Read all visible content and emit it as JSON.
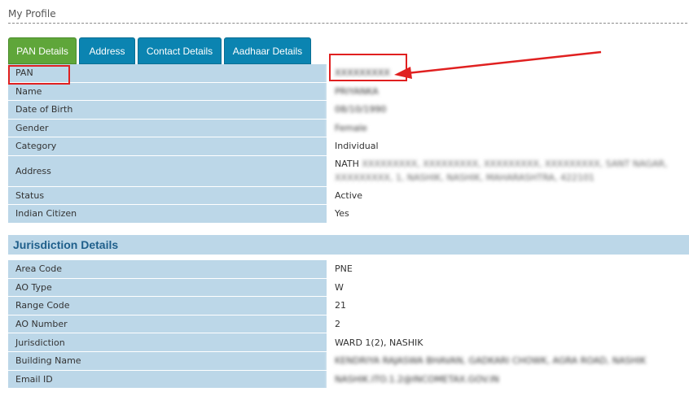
{
  "page": {
    "heading": "My Profile"
  },
  "tabs": [
    {
      "label": "PAN Details",
      "active": true
    },
    {
      "label": "Address",
      "active": false
    },
    {
      "label": "Contact Details",
      "active": false
    },
    {
      "label": "Aadhaar Details",
      "active": false
    }
  ],
  "pan_details": {
    "rows": [
      {
        "label": "PAN",
        "value": "XXXXXXXXX"
      },
      {
        "label": "Name",
        "value": "PRIYANKA"
      },
      {
        "label": "Date of Birth",
        "value": "08/10/1990"
      },
      {
        "label": "Gender",
        "value": "Female"
      },
      {
        "label": "Category",
        "value": "Individual"
      },
      {
        "label": "Address",
        "value_prefix": "NATH",
        "value_line1": "XXXXXXXXX, XXXXXXXXX, XXXXXXXXX, XXXXXXXXX, SANT NAGAR,",
        "value_line2": "XXXXXXXXX, 1, NASHIK, NASHIK, MAHARASHTRA, 422101"
      },
      {
        "label": "Status",
        "value": "Active"
      },
      {
        "label": "Indian Citizen",
        "value": "Yes"
      }
    ]
  },
  "jurisdiction": {
    "title": "Jurisdiction Details",
    "rows": [
      {
        "label": "Area Code",
        "value": "PNE"
      },
      {
        "label": "AO Type",
        "value": "W"
      },
      {
        "label": "Range Code",
        "value": "21"
      },
      {
        "label": "AO Number",
        "value": "2"
      },
      {
        "label": "Jurisdiction",
        "value": "WARD 1(2), NASHIK"
      },
      {
        "label": "Building Name",
        "value": "KENDRIYA RAJASWA BHAVAN, GADKARI CHOWK, AGRA ROAD, NASHIK"
      },
      {
        "label": "Email ID",
        "value": "NASHIK.ITO.1.2@INCOMETAX.GOV.IN"
      }
    ]
  },
  "colors": {
    "active_tab": "#5fa63a",
    "tab": "#0b84b1",
    "label_cell": "#bcd7e8",
    "section_title": "#1f5f8b",
    "annotation": "#e02020"
  }
}
